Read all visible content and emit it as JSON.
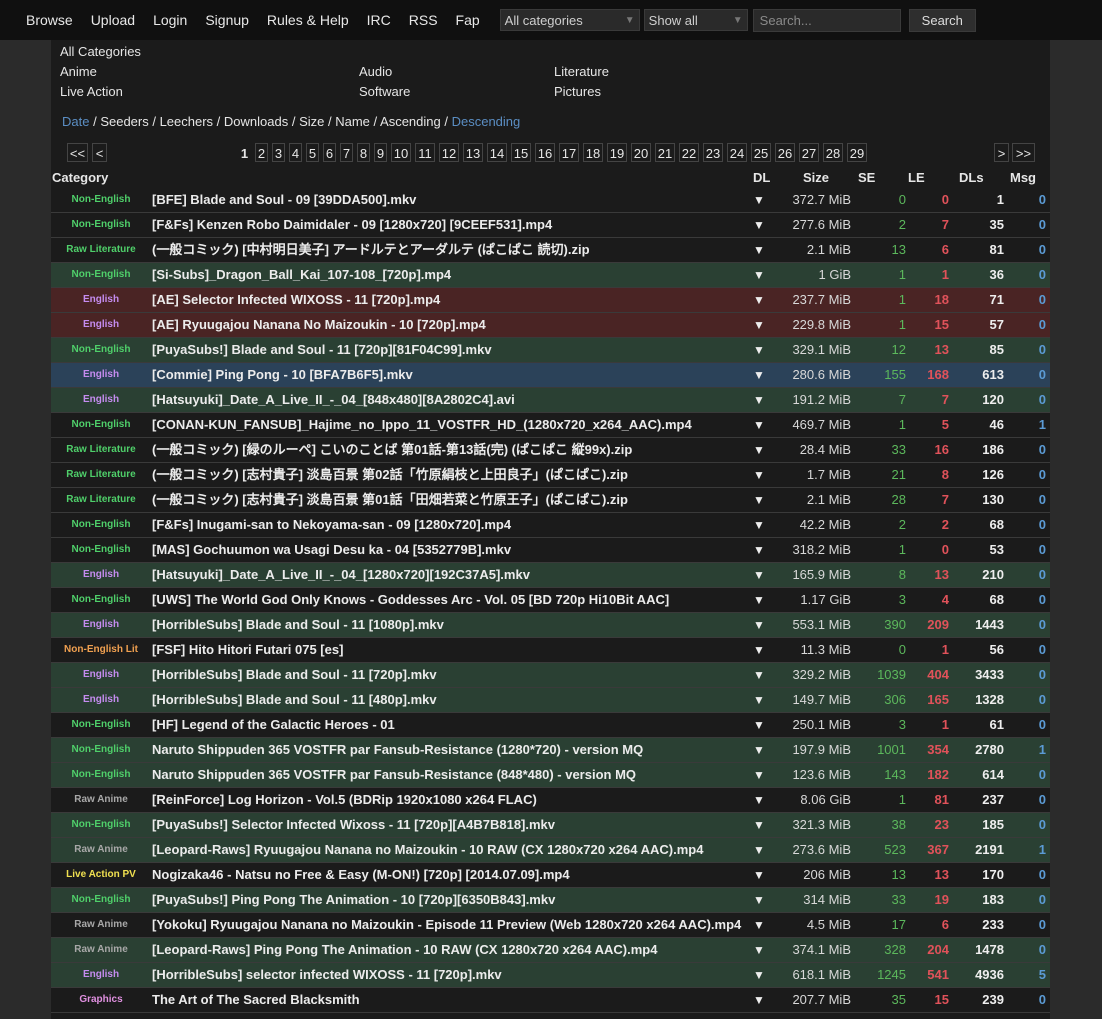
{
  "nav": [
    "Browse",
    "Upload",
    "Login",
    "Signup",
    "Rules & Help",
    "IRC",
    "RSS",
    "Fap"
  ],
  "filters": {
    "category": "All categories",
    "show": "Show all",
    "search_placeholder": "Search...",
    "search_button": "Search"
  },
  "categories": {
    "all": "All Categories",
    "col1": [
      "Anime",
      "Live Action"
    ],
    "col2": [
      "Audio",
      "Software"
    ],
    "col3": [
      "Literature",
      "Pictures"
    ]
  },
  "sort": {
    "items": [
      "Date",
      "Seeders",
      "Leechers",
      "Downloads",
      "Size",
      "Name",
      "Ascending",
      "Descending"
    ],
    "active": [
      "Date",
      "Descending"
    ]
  },
  "pager": {
    "first": "<<",
    "prev": "<",
    "pages": [
      "1",
      "2",
      "3",
      "4",
      "5",
      "6",
      "7",
      "8",
      "9",
      "10",
      "11",
      "12",
      "13",
      "14",
      "15",
      "16",
      "17",
      "18",
      "19",
      "20",
      "21",
      "22",
      "23",
      "24",
      "25",
      "26",
      "27",
      "28",
      "29"
    ],
    "current": "1",
    "next": ">",
    "last": ">>"
  },
  "headers": {
    "category": "Category",
    "dl": "DL",
    "size": "Size",
    "se": "SE",
    "le": "LE",
    "dls": "DLs",
    "msg": "Msg"
  },
  "colors": {
    "non_english": "#4fcf6a",
    "english": "#c58cf0",
    "raw_lit": "#4fcf6a",
    "raw_anime": "#a8a8a8",
    "non_english_lit": "#f0a050",
    "live_action_pv": "#f0e050",
    "graphics": "#e090e0",
    "bg_dark": "#1b1b1b",
    "bg_green": "#2a4033",
    "bg_red": "#4a2424",
    "bg_blue": "#2b4259"
  },
  "dl_icon": "▼",
  "torrents": [
    {
      "cat": "Non-English",
      "type": "non_english",
      "bg": "bg_dark",
      "name": "[BFE] Blade and Soul - 09 [39DDA500].mkv",
      "size": "372.7 MiB",
      "se": "0",
      "le": "0",
      "dls": "1",
      "msg": "0"
    },
    {
      "cat": "Non-English",
      "type": "non_english",
      "bg": "bg_dark",
      "name": "[F&Fs] Kenzen Robo Daimidaler - 09 [1280x720] [9CEEF531].mp4",
      "size": "277.6 MiB",
      "se": "2",
      "le": "7",
      "dls": "35",
      "msg": "0"
    },
    {
      "cat": "Raw Literature",
      "type": "raw_lit",
      "bg": "bg_dark",
      "name": "(一般コミック) [中村明日美子] アードルテとアーダルテ (ぱこぱこ 読切).zip",
      "size": "2.1 MiB",
      "se": "13",
      "le": "6",
      "dls": "81",
      "msg": "0"
    },
    {
      "cat": "Non-English",
      "type": "non_english",
      "bg": "bg_green",
      "name": "[Si-Subs]_Dragon_Ball_Kai_107-108_[720p].mp4",
      "size": "1 GiB",
      "se": "1",
      "le": "1",
      "dls": "36",
      "msg": "0"
    },
    {
      "cat": "English",
      "type": "english",
      "bg": "bg_red",
      "name": "[AE] Selector Infected WIXOSS - 11 [720p].mp4",
      "size": "237.7 MiB",
      "se": "1",
      "le": "18",
      "dls": "71",
      "msg": "0"
    },
    {
      "cat": "English",
      "type": "english",
      "bg": "bg_red",
      "name": "[AE] Ryuugajou Nanana No Maizoukin - 10 [720p].mp4",
      "size": "229.8 MiB",
      "se": "1",
      "le": "15",
      "dls": "57",
      "msg": "0"
    },
    {
      "cat": "Non-English",
      "type": "non_english",
      "bg": "bg_green",
      "name": "[PuyaSubs!] Blade and Soul - 11 [720p][81F04C99].mkv",
      "size": "329.1 MiB",
      "se": "12",
      "le": "13",
      "dls": "85",
      "msg": "0"
    },
    {
      "cat": "English",
      "type": "english",
      "bg": "bg_blue",
      "name": "[Commie] Ping Pong - 10 [BFA7B6F5].mkv",
      "size": "280.6 MiB",
      "se": "155",
      "le": "168",
      "dls": "613",
      "msg": "0"
    },
    {
      "cat": "English",
      "type": "english",
      "bg": "bg_green",
      "name": "[Hatsuyuki]_Date_A_Live_II_-_04_[848x480][8A2802C4].avi",
      "size": "191.2 MiB",
      "se": "7",
      "le": "7",
      "dls": "120",
      "msg": "0"
    },
    {
      "cat": "Non-English",
      "type": "non_english",
      "bg": "bg_dark",
      "name": "[CONAN-KUN_FANSUB]_Hajime_no_Ippo_11_VOSTFR_HD_(1280x720_x264_AAC).mp4",
      "size": "469.7 MiB",
      "se": "1",
      "le": "5",
      "dls": "46",
      "msg": "1"
    },
    {
      "cat": "Raw Literature",
      "type": "raw_lit",
      "bg": "bg_dark",
      "name": "(一般コミック) [緑のルーペ] こいのことば 第01話-第13話(完) (ぱこぱこ 縦99x).zip",
      "size": "28.4 MiB",
      "se": "33",
      "le": "16",
      "dls": "186",
      "msg": "0"
    },
    {
      "cat": "Raw Literature",
      "type": "raw_lit",
      "bg": "bg_dark",
      "name": "(一般コミック) [志村貴子] 淡島百景 第02話「竹原絹枝と上田良子」(ぱこぱこ).zip",
      "size": "1.7 MiB",
      "se": "21",
      "le": "8",
      "dls": "126",
      "msg": "0"
    },
    {
      "cat": "Raw Literature",
      "type": "raw_lit",
      "bg": "bg_dark",
      "name": "(一般コミック) [志村貴子] 淡島百景 第01話「田畑若菜と竹原王子」(ぱこぱこ).zip",
      "size": "2.1 MiB",
      "se": "28",
      "le": "7",
      "dls": "130",
      "msg": "0"
    },
    {
      "cat": "Non-English",
      "type": "non_english",
      "bg": "bg_dark",
      "name": "[F&Fs] Inugami-san to Nekoyama-san - 09 [1280x720].mp4",
      "size": "42.2 MiB",
      "se": "2",
      "le": "2",
      "dls": "68",
      "msg": "0"
    },
    {
      "cat": "Non-English",
      "type": "non_english",
      "bg": "bg_dark",
      "name": "[MAS] Gochuumon wa Usagi Desu ka - 04 [5352779B].mkv",
      "size": "318.2 MiB",
      "se": "1",
      "le": "0",
      "dls": "53",
      "msg": "0"
    },
    {
      "cat": "English",
      "type": "english",
      "bg": "bg_green",
      "name": "[Hatsuyuki]_Date_A_Live_II_-_04_[1280x720][192C37A5].mkv",
      "size": "165.9 MiB",
      "se": "8",
      "le": "13",
      "dls": "210",
      "msg": "0"
    },
    {
      "cat": "Non-English",
      "type": "non_english",
      "bg": "bg_dark",
      "name": "[UWS] The World God Only Knows - Goddesses Arc - Vol. 05 [BD 720p Hi10Bit AAC]",
      "size": "1.17 GiB",
      "se": "3",
      "le": "4",
      "dls": "68",
      "msg": "0"
    },
    {
      "cat": "English",
      "type": "english",
      "bg": "bg_green",
      "name": "[HorribleSubs] Blade and Soul - 11 [1080p].mkv",
      "size": "553.1 MiB",
      "se": "390",
      "le": "209",
      "dls": "1443",
      "msg": "0"
    },
    {
      "cat": "Non-English Lit",
      "type": "non_english_lit",
      "bg": "bg_dark",
      "name": "[FSF] Hito Hitori Futari 075 [es]",
      "size": "11.3 MiB",
      "se": "0",
      "le": "1",
      "dls": "56",
      "msg": "0"
    },
    {
      "cat": "English",
      "type": "english",
      "bg": "bg_green",
      "name": "[HorribleSubs] Blade and Soul - 11 [720p].mkv",
      "size": "329.2 MiB",
      "se": "1039",
      "le": "404",
      "dls": "3433",
      "msg": "0"
    },
    {
      "cat": "English",
      "type": "english",
      "bg": "bg_green",
      "name": "[HorribleSubs] Blade and Soul - 11 [480p].mkv",
      "size": "149.7 MiB",
      "se": "306",
      "le": "165",
      "dls": "1328",
      "msg": "0"
    },
    {
      "cat": "Non-English",
      "type": "non_english",
      "bg": "bg_dark",
      "name": "[HF] Legend of the Galactic Heroes - 01",
      "size": "250.1 MiB",
      "se": "3",
      "le": "1",
      "dls": "61",
      "msg": "0"
    },
    {
      "cat": "Non-English",
      "type": "non_english",
      "bg": "bg_green",
      "name": "Naruto Shippuden 365 VOSTFR par Fansub-Resistance (1280*720) - version MQ",
      "size": "197.9 MiB",
      "se": "1001",
      "le": "354",
      "dls": "2780",
      "msg": "1"
    },
    {
      "cat": "Non-English",
      "type": "non_english",
      "bg": "bg_green",
      "name": "Naruto Shippuden 365 VOSTFR par Fansub-Resistance (848*480) - version MQ",
      "size": "123.6 MiB",
      "se": "143",
      "le": "182",
      "dls": "614",
      "msg": "0"
    },
    {
      "cat": "Raw Anime",
      "type": "raw_anime",
      "bg": "bg_dark",
      "name": "[ReinForce] Log Horizon - Vol.5 (BDRip 1920x1080 x264 FLAC)",
      "size": "8.06 GiB",
      "se": "1",
      "le": "81",
      "dls": "237",
      "msg": "0"
    },
    {
      "cat": "Non-English",
      "type": "non_english",
      "bg": "bg_green",
      "name": "[PuyaSubs!] Selector Infected Wixoss - 11 [720p][A4B7B818].mkv",
      "size": "321.3 MiB",
      "se": "38",
      "le": "23",
      "dls": "185",
      "msg": "0"
    },
    {
      "cat": "Raw Anime",
      "type": "raw_anime",
      "bg": "bg_green",
      "name": "[Leopard-Raws] Ryuugajou Nanana no Maizoukin - 10 RAW (CX 1280x720 x264 AAC).mp4",
      "size": "273.6 MiB",
      "se": "523",
      "le": "367",
      "dls": "2191",
      "msg": "1"
    },
    {
      "cat": "Live Action PV",
      "type": "live_action_pv",
      "bg": "bg_dark",
      "name": "Nogizaka46 - Natsu no Free & Easy (M-ON!) [720p] [2014.07.09].mp4",
      "size": "206 MiB",
      "se": "13",
      "le": "13",
      "dls": "170",
      "msg": "0"
    },
    {
      "cat": "Non-English",
      "type": "non_english",
      "bg": "bg_green",
      "name": "[PuyaSubs!] Ping Pong The Animation - 10 [720p][6350B843].mkv",
      "size": "314 MiB",
      "se": "33",
      "le": "19",
      "dls": "183",
      "msg": "0"
    },
    {
      "cat": "Raw Anime",
      "type": "raw_anime",
      "bg": "bg_dark",
      "name": "[Yokoku] Ryuugajou Nanana no Maizoukin - Episode 11 Preview (Web 1280x720 x264 AAC).mp4",
      "size": "4.5 MiB",
      "se": "17",
      "le": "6",
      "dls": "233",
      "msg": "0"
    },
    {
      "cat": "Raw Anime",
      "type": "raw_anime",
      "bg": "bg_green",
      "name": "[Leopard-Raws] Ping Pong The Animation - 10 RAW (CX 1280x720 x264 AAC).mp4",
      "size": "374.1 MiB",
      "se": "328",
      "le": "204",
      "dls": "1478",
      "msg": "0"
    },
    {
      "cat": "English",
      "type": "english",
      "bg": "bg_green",
      "name": "[HorribleSubs] selector infected WIXOSS - 11 [720p].mkv",
      "size": "618.1 MiB",
      "se": "1245",
      "le": "541",
      "dls": "4936",
      "msg": "5"
    },
    {
      "cat": "Graphics",
      "type": "graphics",
      "bg": "bg_dark",
      "name": "The Art of The Sacred Blacksmith",
      "size": "207.7 MiB",
      "se": "35",
      "le": "15",
      "dls": "239",
      "msg": "0"
    }
  ]
}
